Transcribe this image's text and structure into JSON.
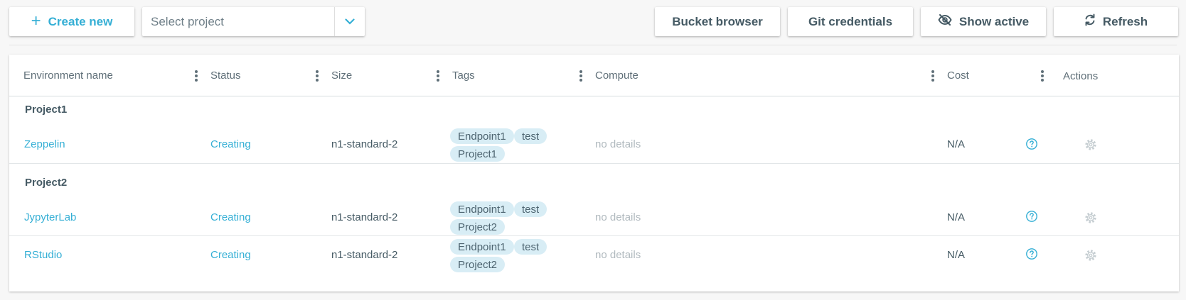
{
  "toolbar": {
    "create_label": "Create new",
    "create_icon": "plus-icon",
    "project_select_placeholder": "Select project",
    "bucket_label": "Bucket browser",
    "git_label": "Git credentials",
    "show_active_label": "Show active",
    "show_active_icon": "eye-off-icon",
    "refresh_label": "Refresh",
    "refresh_icon": "refresh-icon"
  },
  "table": {
    "columns": [
      "Environment name",
      "Status",
      "Size",
      "Tags",
      "Compute",
      "Cost",
      "Actions"
    ],
    "groups": [
      {
        "project": "Project1",
        "rows": [
          {
            "name": "Zeppelin",
            "status": "Creating",
            "size": "n1-standard-2",
            "tags": [
              "Endpoint1",
              "test",
              "Project1"
            ],
            "compute": "no details",
            "cost": "N/A"
          }
        ]
      },
      {
        "project": "Project2",
        "rows": [
          {
            "name": "JypyterLab",
            "status": "Creating",
            "size": "n1-standard-2",
            "tags": [
              "Endpoint1",
              "test",
              "Project2"
            ],
            "compute": "no details",
            "cost": "N/A"
          },
          {
            "name": "RStudio",
            "status": "Creating",
            "size": "n1-standard-2",
            "tags": [
              "Endpoint1",
              "test",
              "Project2"
            ],
            "compute": "no details",
            "cost": "N/A"
          }
        ]
      }
    ]
  },
  "colors": {
    "accent": "#35afd5",
    "text": "#455a64",
    "muted": "#b0b9be",
    "tag_bg": "#d8edf5",
    "background": "#f7f7f7"
  }
}
